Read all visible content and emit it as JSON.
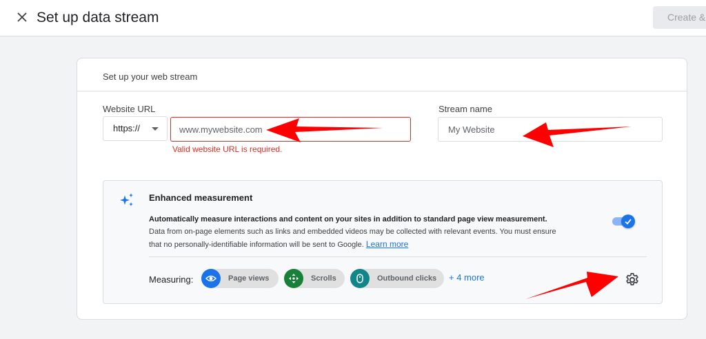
{
  "header": {
    "title": "Set up data stream",
    "create_label": "Create &"
  },
  "card": {
    "title": "Set up your web stream"
  },
  "website_url": {
    "label": "Website URL",
    "protocol": "https://",
    "placeholder": "www.mywebsite.com",
    "error": "Valid website URL is required."
  },
  "stream_name": {
    "label": "Stream name",
    "placeholder": "My Website"
  },
  "enhanced": {
    "title": "Enhanced measurement",
    "desc_strong": "Automatically measure interactions and content on your sites in addition to standard page view measurement.",
    "desc_normal": "Data from on-page elements such as links and embedded videos may be collected with relevant events. You must ensure that no personally-identifiable information will be sent to Google.",
    "learn_more": "Learn more",
    "toggle_on": true,
    "measuring_label": "Measuring:",
    "chips": [
      {
        "label": "Page views",
        "icon": "eye-icon",
        "color": "#1a73e8"
      },
      {
        "label": "Scrolls",
        "icon": "move-arrows-icon",
        "color": "#188038"
      },
      {
        "label": "Outbound clicks",
        "icon": "mouse-icon",
        "color": "#12858a"
      }
    ],
    "more_label": "+ 4 more"
  },
  "colors": {
    "accent": "#1a73e8",
    "error": "#d93025",
    "annotation_arrow": "#ff0000"
  }
}
